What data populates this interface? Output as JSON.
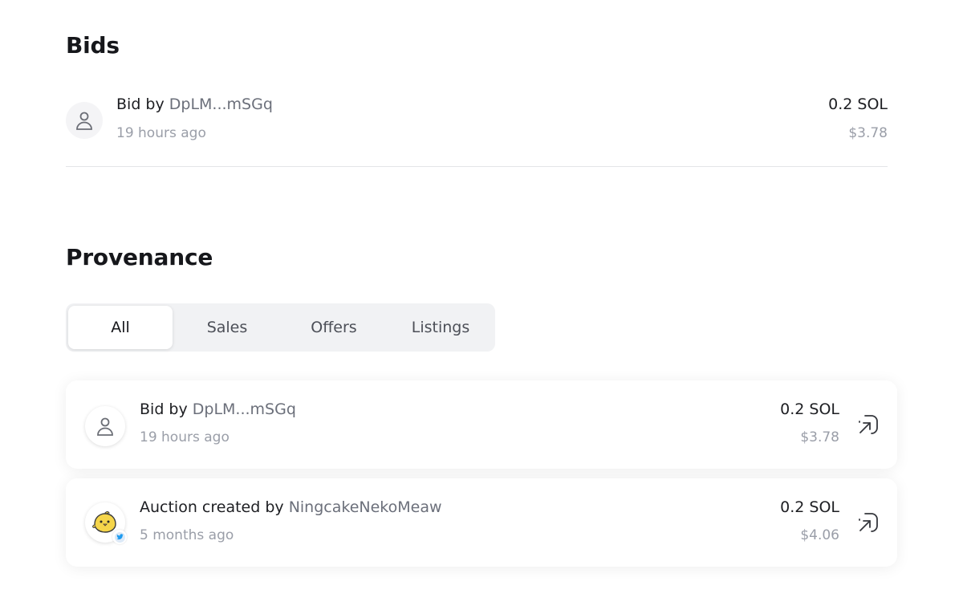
{
  "bids": {
    "title": "Bids",
    "items": [
      {
        "prefix": "Bid by",
        "address": "DpLM...mSGq",
        "time": "19 hours ago",
        "price": "0.2 SOL",
        "usd": "$3.78",
        "avatar_icon": "user-icon"
      }
    ]
  },
  "provenance": {
    "title": "Provenance",
    "tabs": [
      {
        "label": "All",
        "active": true
      },
      {
        "label": "Sales",
        "active": false
      },
      {
        "label": "Offers",
        "active": false
      },
      {
        "label": "Listings",
        "active": false
      }
    ],
    "items": [
      {
        "prefix": "Bid by",
        "address": "DpLM...mSGq",
        "time": "19 hours ago",
        "price": "0.2 SOL",
        "usd": "$3.78",
        "avatar_icon": "user-icon",
        "action_icon": "external-link-icon"
      },
      {
        "prefix": "Auction created by",
        "address": "NingcakeNekoMeaw",
        "time": "5 months ago",
        "price": "0.2 SOL",
        "usd": "$4.06",
        "avatar_icon": "chick-avatar-icon",
        "badge_icon": "twitter-icon",
        "action_icon": "external-link-icon"
      }
    ]
  },
  "colors": {
    "text": "#1d1e22",
    "muted": "#9a9ea8",
    "address": "#6b6f7a",
    "tab_bg": "#f1f2f4",
    "avatar_yellow": "#f5d54a"
  }
}
